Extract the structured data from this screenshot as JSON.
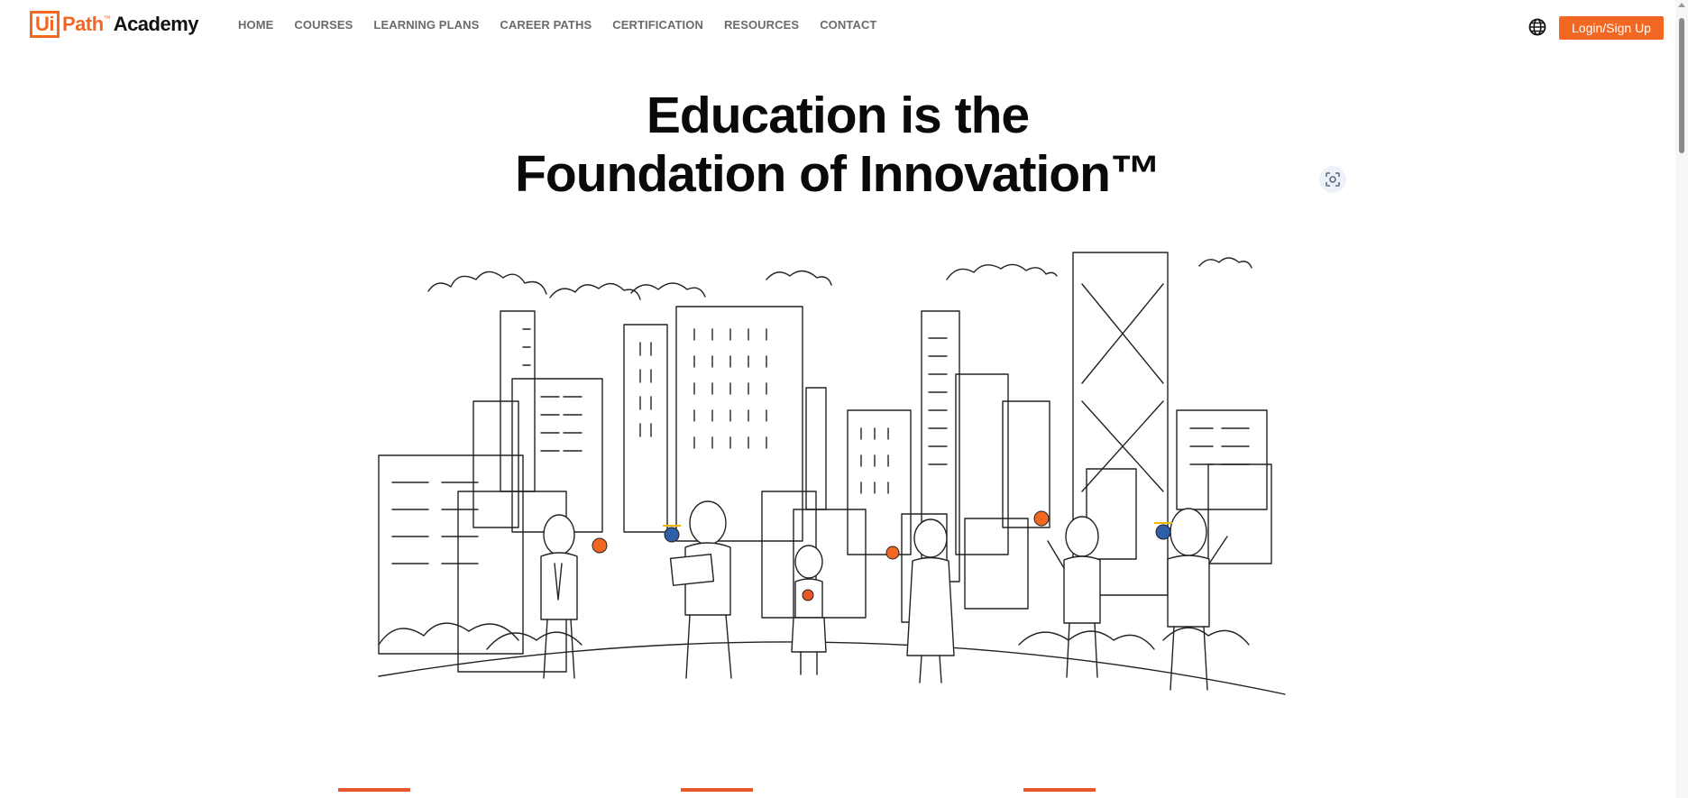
{
  "logo": {
    "ui": "Ui",
    "path": "Path",
    "tm": "™",
    "academy": "Academy"
  },
  "nav": {
    "items": [
      {
        "label": "HOME"
      },
      {
        "label": "COURSES"
      },
      {
        "label": "LEARNING PLANS"
      },
      {
        "label": "CAREER PATHS"
      },
      {
        "label": "CERTIFICATION"
      },
      {
        "label": "RESOURCES"
      },
      {
        "label": "CONTACT"
      }
    ]
  },
  "header": {
    "login_label": "Login/Sign Up"
  },
  "hero": {
    "title_line1": "Education is the",
    "title_line2": "Foundation of Innovation™"
  },
  "icons": {
    "globe": "globe-icon",
    "scan": "scan-icon",
    "logo": "uipath-logo"
  },
  "colors": {
    "accent": "#f26722",
    "tab_accent": "#e8572a",
    "nav_text": "#6b6b6b"
  }
}
